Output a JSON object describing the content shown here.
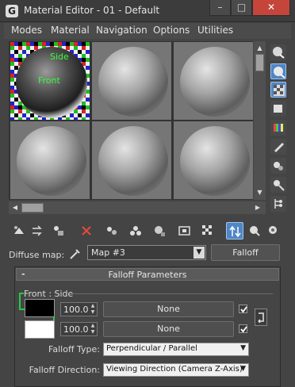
{
  "window": {
    "title": "Material Editor - 01 - Default",
    "icon_name": "3dsmax-app-icon",
    "minimize_label": "–",
    "maximize_label": "□",
    "close_label": "✕"
  },
  "menu": [
    "Modes",
    "Material",
    "Navigation",
    "Options",
    "Utilities"
  ],
  "slots": {
    "active_slot": 1,
    "active_slot_label_side": "Side",
    "active_slot_label_front": "Front",
    "count_visible": 6
  },
  "diffuse": {
    "label": "Diffuse map:",
    "map_name": "Map #3",
    "type_button": "Falloff"
  },
  "rollout": {
    "title": "Falloff Parameters",
    "collapse": "-",
    "group_label": "Front : Side",
    "rows": [
      {
        "color": "#000000",
        "value": "100.0",
        "map": "None",
        "checked": true
      },
      {
        "color": "#ffffff",
        "value": "100.0",
        "map": "None",
        "checked": true
      }
    ],
    "falloff_type_label": "Falloff Type:",
    "falloff_type_value": "Perpendicular / Parallel",
    "falloff_direction_label": "Falloff Direction:",
    "falloff_direction_value": "Viewing Direction (Camera Z-Axis)"
  },
  "colors": {
    "accent": "#4f86c6",
    "close_red": "#c5453b",
    "label_green": "#33ff33"
  }
}
